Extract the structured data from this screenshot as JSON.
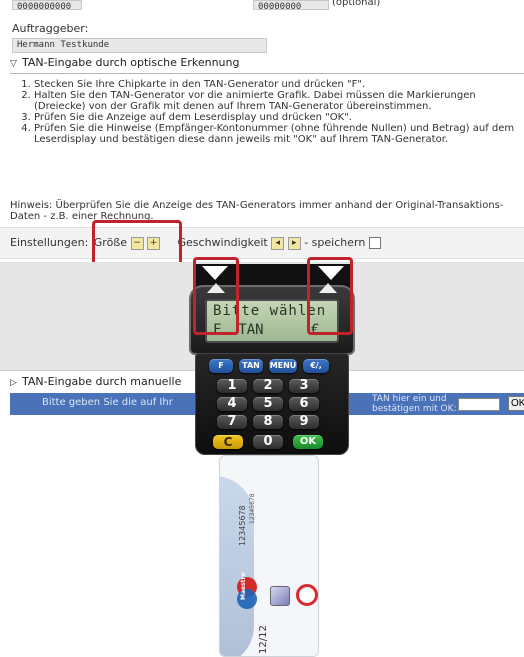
{
  "top": {
    "field1_value": "0000000000",
    "field2_value": "00000000",
    "field2_suffix": "(optional)"
  },
  "client": {
    "label": "Auftraggeber:",
    "value": "Hermann Testkunde"
  },
  "optical": {
    "header": "TAN-Eingabe durch optische Erkennung",
    "steps": [
      "Stecken Sie Ihre Chipkarte in den TAN-Generator und drücken \"F\".",
      "Halten Sie den TAN-Generator vor die animierte Grafik. Dabei müssen die Markierungen (Dreiecke) von der Grafik mit denen auf Ihrem TAN-Generator übereinstimmen.",
      "Prüfen Sie die Anzeige auf dem Leserdisplay und drücken \"OK\".",
      "Prüfen Sie die Hinweise (Empfänger-Kontonummer (ohne führende Nullen) und Betrag) auf dem Leserdisplay und bestätigen diese dann jeweils mit \"OK\" auf Ihrem TAN-Generator."
    ],
    "hint": "Hinweis: Überprüfen Sie die Anzeige des TAN-Generators immer anhand der Original-Transaktions-Daten - z.B. einer Rechnung.",
    "settings": {
      "label": "Einstellungen:",
      "size_label": "Größe",
      "speed_label": "Geschwindigkeit",
      "save_label": "- speichern"
    }
  },
  "manual": {
    "header": "TAN-Eingabe durch manuelle",
    "prompt_left": "Bitte geben Sie die auf Ihr",
    "prompt_right_line1": "TAN hier ein und",
    "prompt_right_line2": "bestätigen mit OK:",
    "ok_label": "OK"
  },
  "device": {
    "display_line1": "Bitte wählen",
    "display_line2_left": "F  TAN",
    "display_line2_right": "€",
    "keys": {
      "f": "F",
      "tan": "TAN",
      "menu": "MENU",
      "euro": "€/,",
      "k1": "1",
      "k2": "2",
      "k3": "3",
      "k4": "4",
      "k5": "5",
      "k6": "6",
      "k7": "7",
      "k8": "8",
      "k9": "9",
      "c": "C",
      "k0": "0",
      "ok": "OK"
    }
  },
  "card": {
    "account_no": "12345678",
    "bank_code": "12345678",
    "expiry": "12/12",
    "brand": "Maestro"
  },
  "colors": {
    "blue_bar": "#4a72b9",
    "highlight_red": "#c2232a",
    "key_blue": "#2d62b5"
  }
}
